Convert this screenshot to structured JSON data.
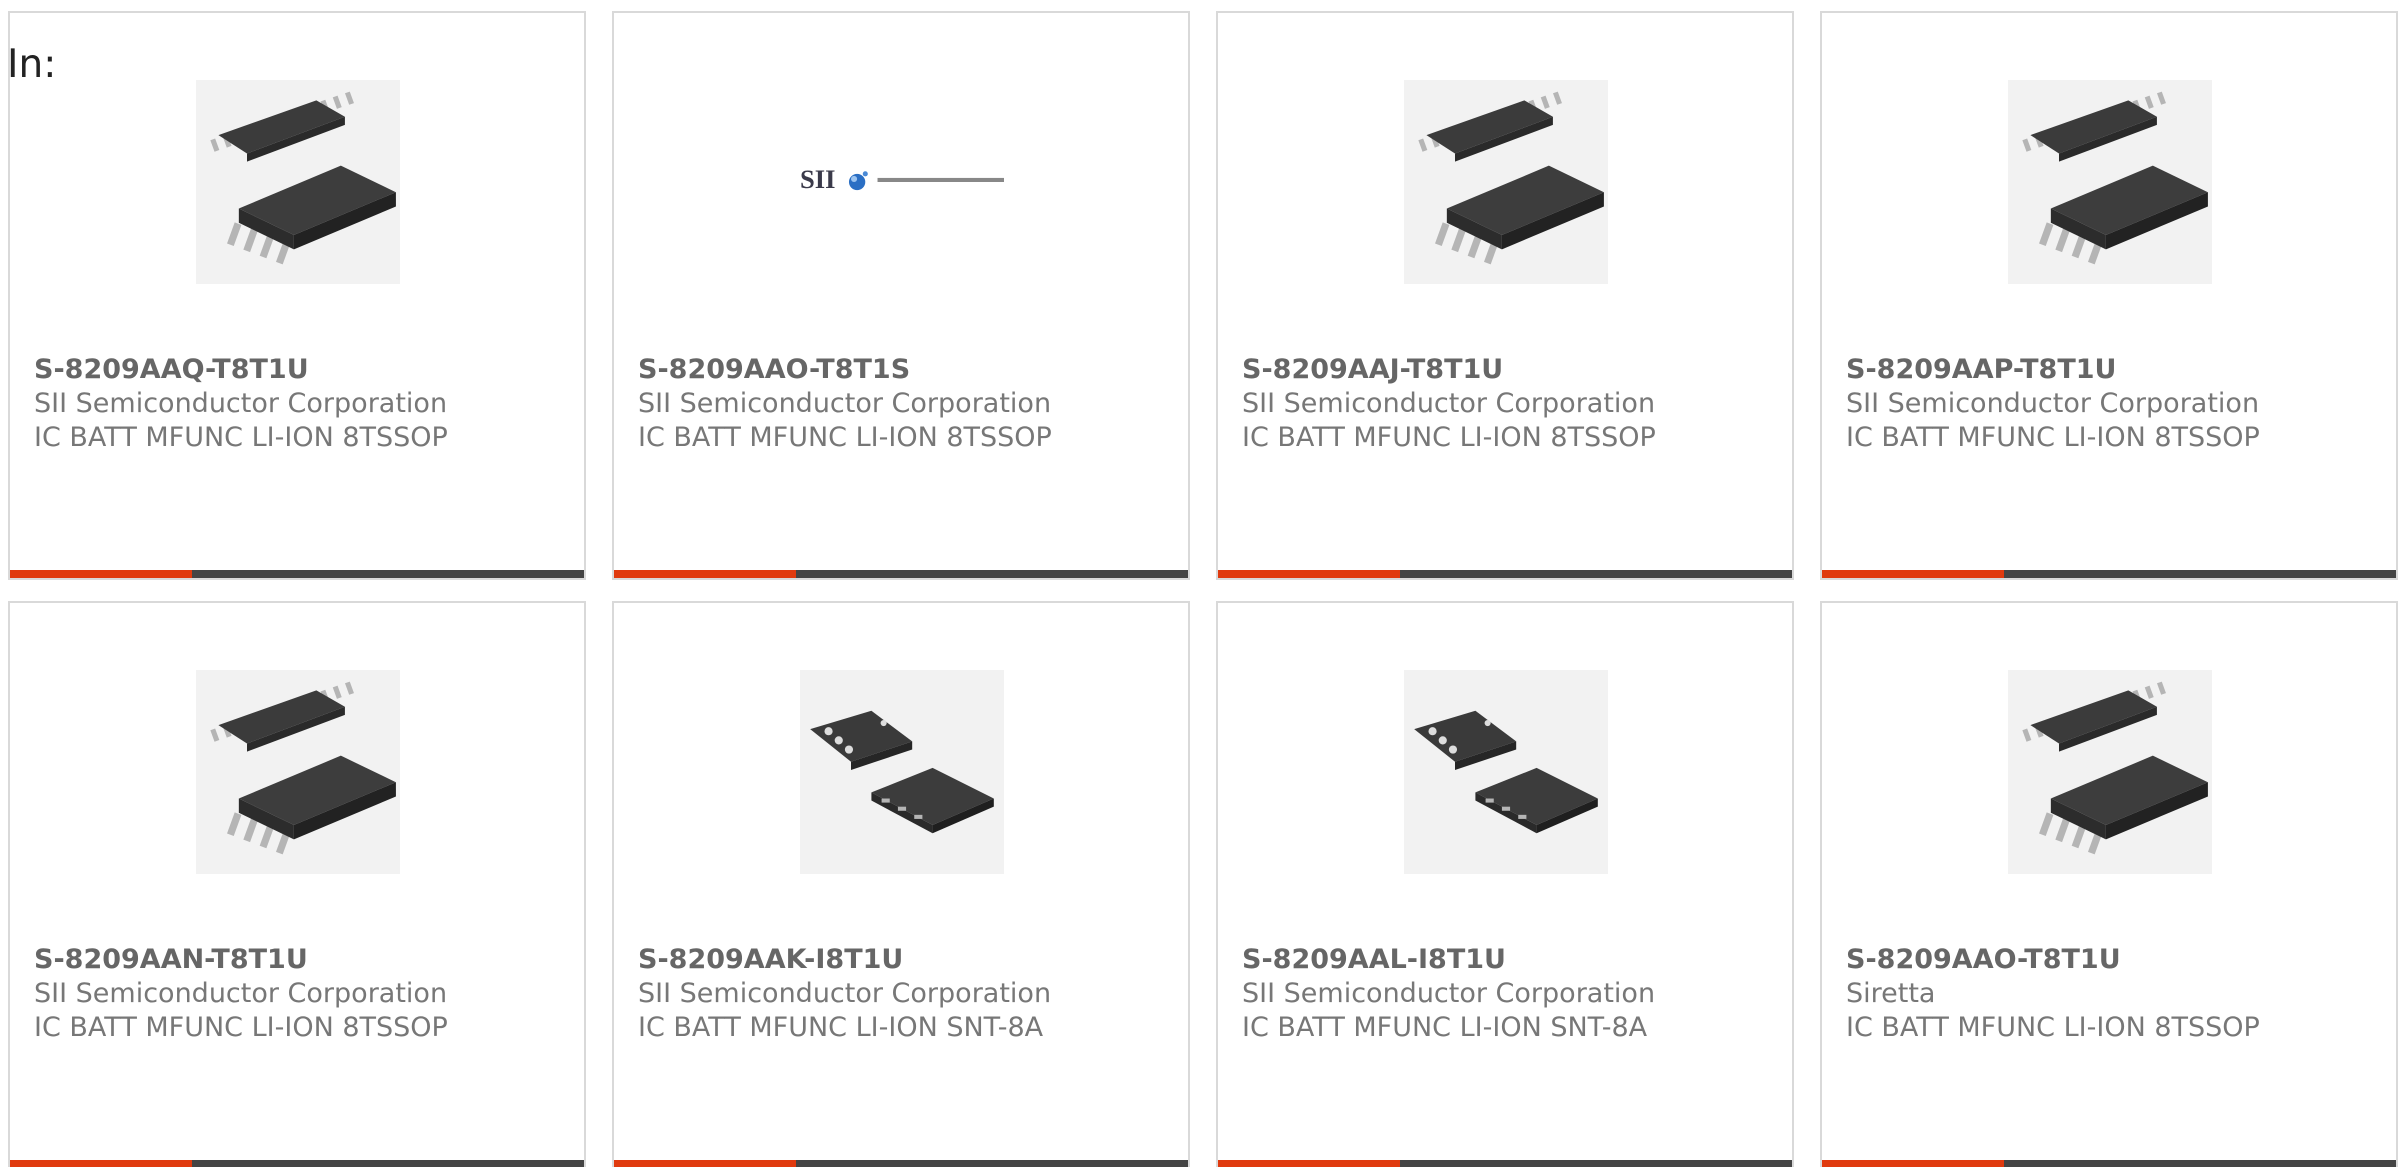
{
  "header": {
    "label": "In:"
  },
  "colors": {
    "accent": "#e03a0e",
    "bar": "#444444",
    "text": "#777777",
    "border": "#d9d9d9"
  },
  "products": [
    {
      "part": "S-8209AAQ-T8T1U",
      "manufacturer": "SII Semiconductor Corporation",
      "description": "IC BATT MFUNC LI-ION 8TSSOP",
      "image": "tssop-chip-photo"
    },
    {
      "part": "S-8209AAO-T8T1S",
      "manufacturer": "SII Semiconductor Corporation",
      "description": "IC BATT MFUNC LI-ION 8TSSOP",
      "image": "sii-logo"
    },
    {
      "part": "S-8209AAJ-T8T1U",
      "manufacturer": "SII Semiconductor Corporation",
      "description": "IC BATT MFUNC LI-ION 8TSSOP",
      "image": "tssop-chip-photo"
    },
    {
      "part": "S-8209AAP-T8T1U",
      "manufacturer": "SII Semiconductor Corporation",
      "description": "IC BATT MFUNC LI-ION 8TSSOP",
      "image": "tssop-chip-photo"
    },
    {
      "part": "S-8209AAN-T8T1U",
      "manufacturer": "SII Semiconductor Corporation",
      "description": "IC BATT MFUNC LI-ION 8TSSOP",
      "image": "tssop-chip-photo"
    },
    {
      "part": "S-8209AAK-I8T1U",
      "manufacturer": "SII Semiconductor Corporation",
      "description": "IC BATT MFUNC LI-ION SNT-8A",
      "image": "snt-chip-photo"
    },
    {
      "part": "S-8209AAL-I8T1U",
      "manufacturer": "SII Semiconductor Corporation",
      "description": "IC BATT MFUNC LI-ION SNT-8A",
      "image": "snt-chip-photo"
    },
    {
      "part": "S-8209AAO-T8T1U",
      "manufacturer": "Siretta",
      "description": "IC BATT MFUNC LI-ION 8TSSOP",
      "image": "tssop-chip-photo"
    }
  ],
  "logo": {
    "mark": "SII",
    "company": "SII Semiconductor Corporation"
  }
}
